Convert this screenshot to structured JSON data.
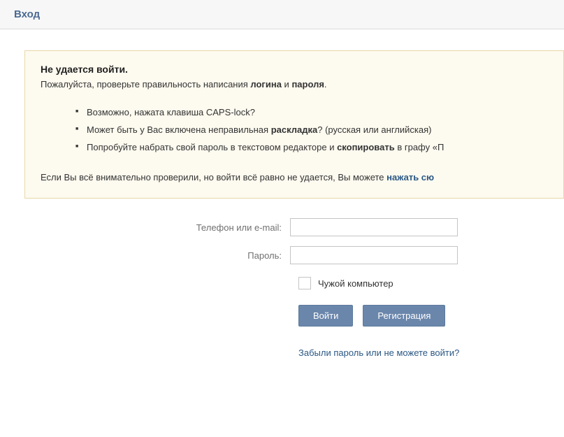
{
  "header": {
    "title": "Вход"
  },
  "error": {
    "title": "Не удается войти.",
    "check_prefix": "Пожалуйста, проверьте правильность написания ",
    "check_bold1": "логина",
    "check_mid": " и ",
    "check_bold2": "пароля",
    "check_suffix": ".",
    "item1": "Возможно, нажата клавиша CAPS-lock?",
    "item2_pre": "Может быть у Вас включена неправильная ",
    "item2_bold": "раскладка",
    "item2_post": "? (русская или английская)",
    "item3_pre": "Попробуйте набрать свой пароль в текстовом редакторе и ",
    "item3_bold": "скопировать",
    "item3_post": " в графу «П",
    "footer_pre": "Если Вы всё внимательно проверили, но войти всё равно не удается, Вы можете ",
    "footer_link": "нажать сю"
  },
  "form": {
    "email_label": "Телефон или e-mail:",
    "password_label": "Пароль:",
    "remember_label": "Чужой компьютер",
    "login_btn": "Войти",
    "register_btn": "Регистрация",
    "forgot": "Забыли пароль или не можете войти?"
  }
}
